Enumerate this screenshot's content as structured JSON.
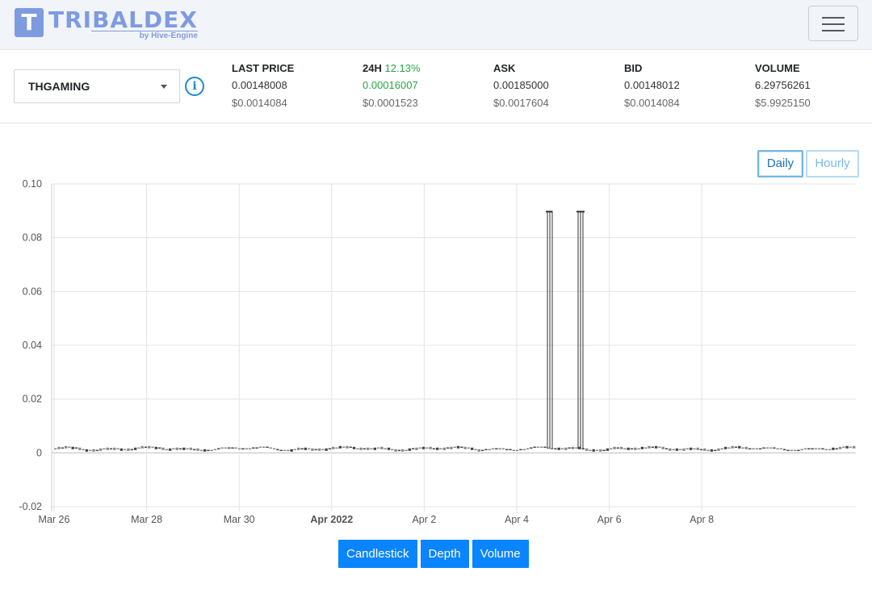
{
  "header": {
    "logo_letter": "T",
    "logo_name": "TRIBALDEX",
    "logo_sub": "by Hive-Engine",
    "menu_icon": "hamburger-icon"
  },
  "ticker": {
    "token": "THGAMING",
    "stats": [
      {
        "label": "LAST PRICE",
        "pct": "",
        "value": "0.00148008",
        "usd": "$0.0014084"
      },
      {
        "label": "24H",
        "pct": "12.13%",
        "value": "0.00016007",
        "usd": "$0.0001523"
      },
      {
        "label": "ASK",
        "pct": "",
        "value": "0.00185000",
        "usd": "$0.0017604"
      },
      {
        "label": "BID",
        "pct": "",
        "value": "0.00148012",
        "usd": "$0.0014084"
      },
      {
        "label": "VOLUME",
        "pct": "",
        "value": "6.29756261",
        "usd": "$5.9925150"
      }
    ]
  },
  "toggle": {
    "daily": "Daily",
    "hourly": "Hourly"
  },
  "colors": {
    "accent": "#0a84ff",
    "positive": "#28a745",
    "logo": "#7f9be0",
    "candle": "#555555"
  },
  "chart_data": {
    "type": "candlestick",
    "ylim": [
      -0.02,
      0.1
    ],
    "y_ticks": [
      0.1,
      0.08,
      0.06,
      0.04,
      0.02,
      0,
      -0.02
    ],
    "y_tick_labels": [
      "0.10",
      "0.08",
      "0.06",
      "0.04",
      "0.02",
      "0",
      "-0.02"
    ],
    "x_ticks": [
      {
        "label": "Mar 26",
        "day": 0
      },
      {
        "label": "Mar 28",
        "day": 2
      },
      {
        "label": "Mar 30",
        "day": 4
      },
      {
        "label": "Apr 2022",
        "day": 6,
        "bold": true
      },
      {
        "label": "Apr 2",
        "day": 8
      },
      {
        "label": "Apr 4",
        "day": 10
      },
      {
        "label": "Apr 6",
        "day": 12
      },
      {
        "label": "Apr 8",
        "day": 14
      }
    ],
    "typical_value": 0.0015,
    "spikes": [
      {
        "date": "Apr 4",
        "high": 0.09
      },
      {
        "date": "Apr 4",
        "high": 0.09
      },
      {
        "date": "Apr 4",
        "high": 0.09
      },
      {
        "date": "Apr 4",
        "high": 0.09
      },
      {
        "date": "Apr 4",
        "high": 0.09
      }
    ]
  },
  "bottom_buttons": [
    "Candlestick",
    "Depth",
    "Volume"
  ]
}
